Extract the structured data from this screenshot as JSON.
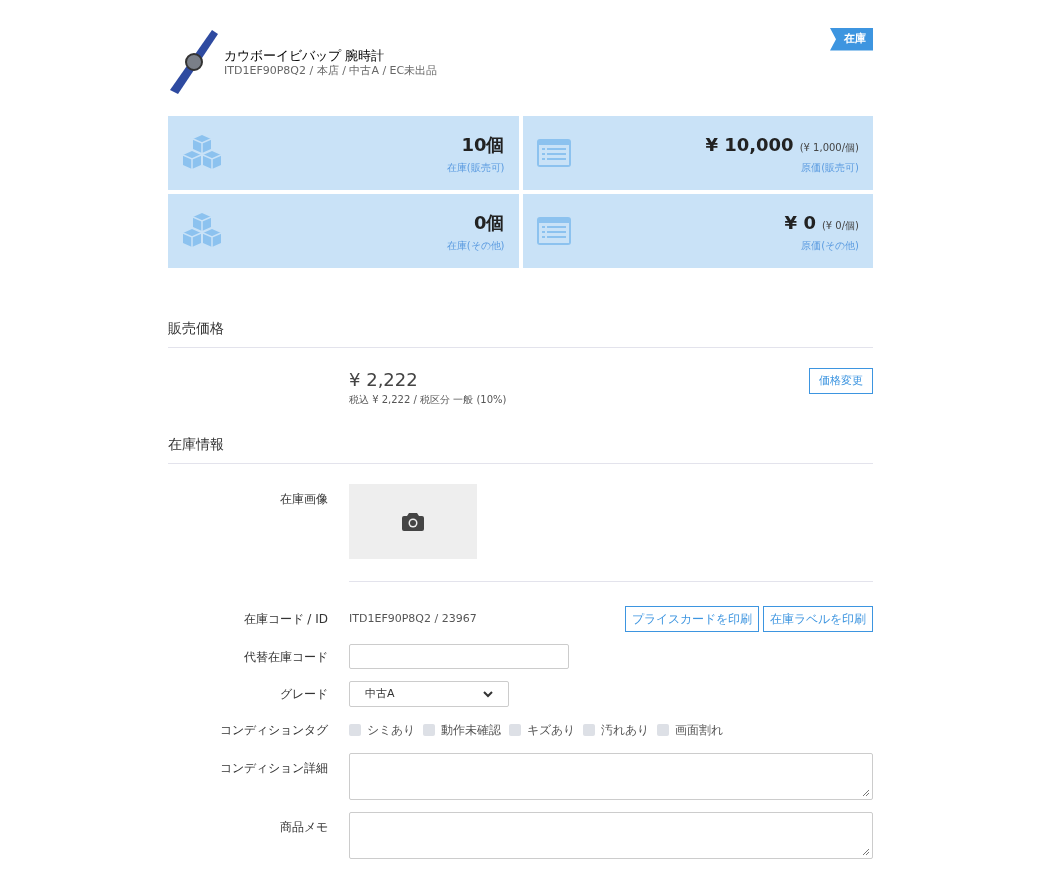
{
  "product": {
    "name": "カウボーイビバップ 腕時計",
    "meta": "ITD1EF90P8Q2 / 本店 / 中古A / EC未出品",
    "status_badge": "在庫"
  },
  "stats": [
    {
      "kind": "stock",
      "value": "10個",
      "label": "在庫(販売可)"
    },
    {
      "kind": "cost",
      "value": "¥ 10,000",
      "unit": "(¥ 1,000/個)",
      "label": "原価(販売可)"
    },
    {
      "kind": "stock",
      "value": "0個",
      "label": "在庫(その他)"
    },
    {
      "kind": "cost",
      "value": "¥ 0",
      "unit": "(¥ 0/個)",
      "label": "原価(その他)"
    }
  ],
  "price_section": {
    "title": "販売価格",
    "price": "¥ 2,222",
    "detail": "税込 ¥ 2,222 / 税区分 一般 (10%)",
    "button": "価格変更"
  },
  "stock_section": {
    "title": "在庫情報",
    "image_label": "在庫画像",
    "code_label": "在庫コード / ID",
    "code_value": "ITD1EF90P8Q2 / 23967",
    "print_buttons": [
      "プライスカードを印刷",
      "在庫ラベルを印刷"
    ],
    "alt_code_label": "代替在庫コード",
    "grade_label": "グレード",
    "grade_value": "中古A",
    "tags_label": "コンディションタグ",
    "tags": [
      {
        "label": "シミあり",
        "checked": false
      },
      {
        "label": "動作未確認",
        "checked": false
      },
      {
        "label": "キズあり",
        "checked": false
      },
      {
        "label": "汚れあり",
        "checked": false
      },
      {
        "label": "画面割れ",
        "checked": false
      }
    ],
    "condition_label": "コンディション詳細",
    "memo_label": "商品メモ"
  }
}
